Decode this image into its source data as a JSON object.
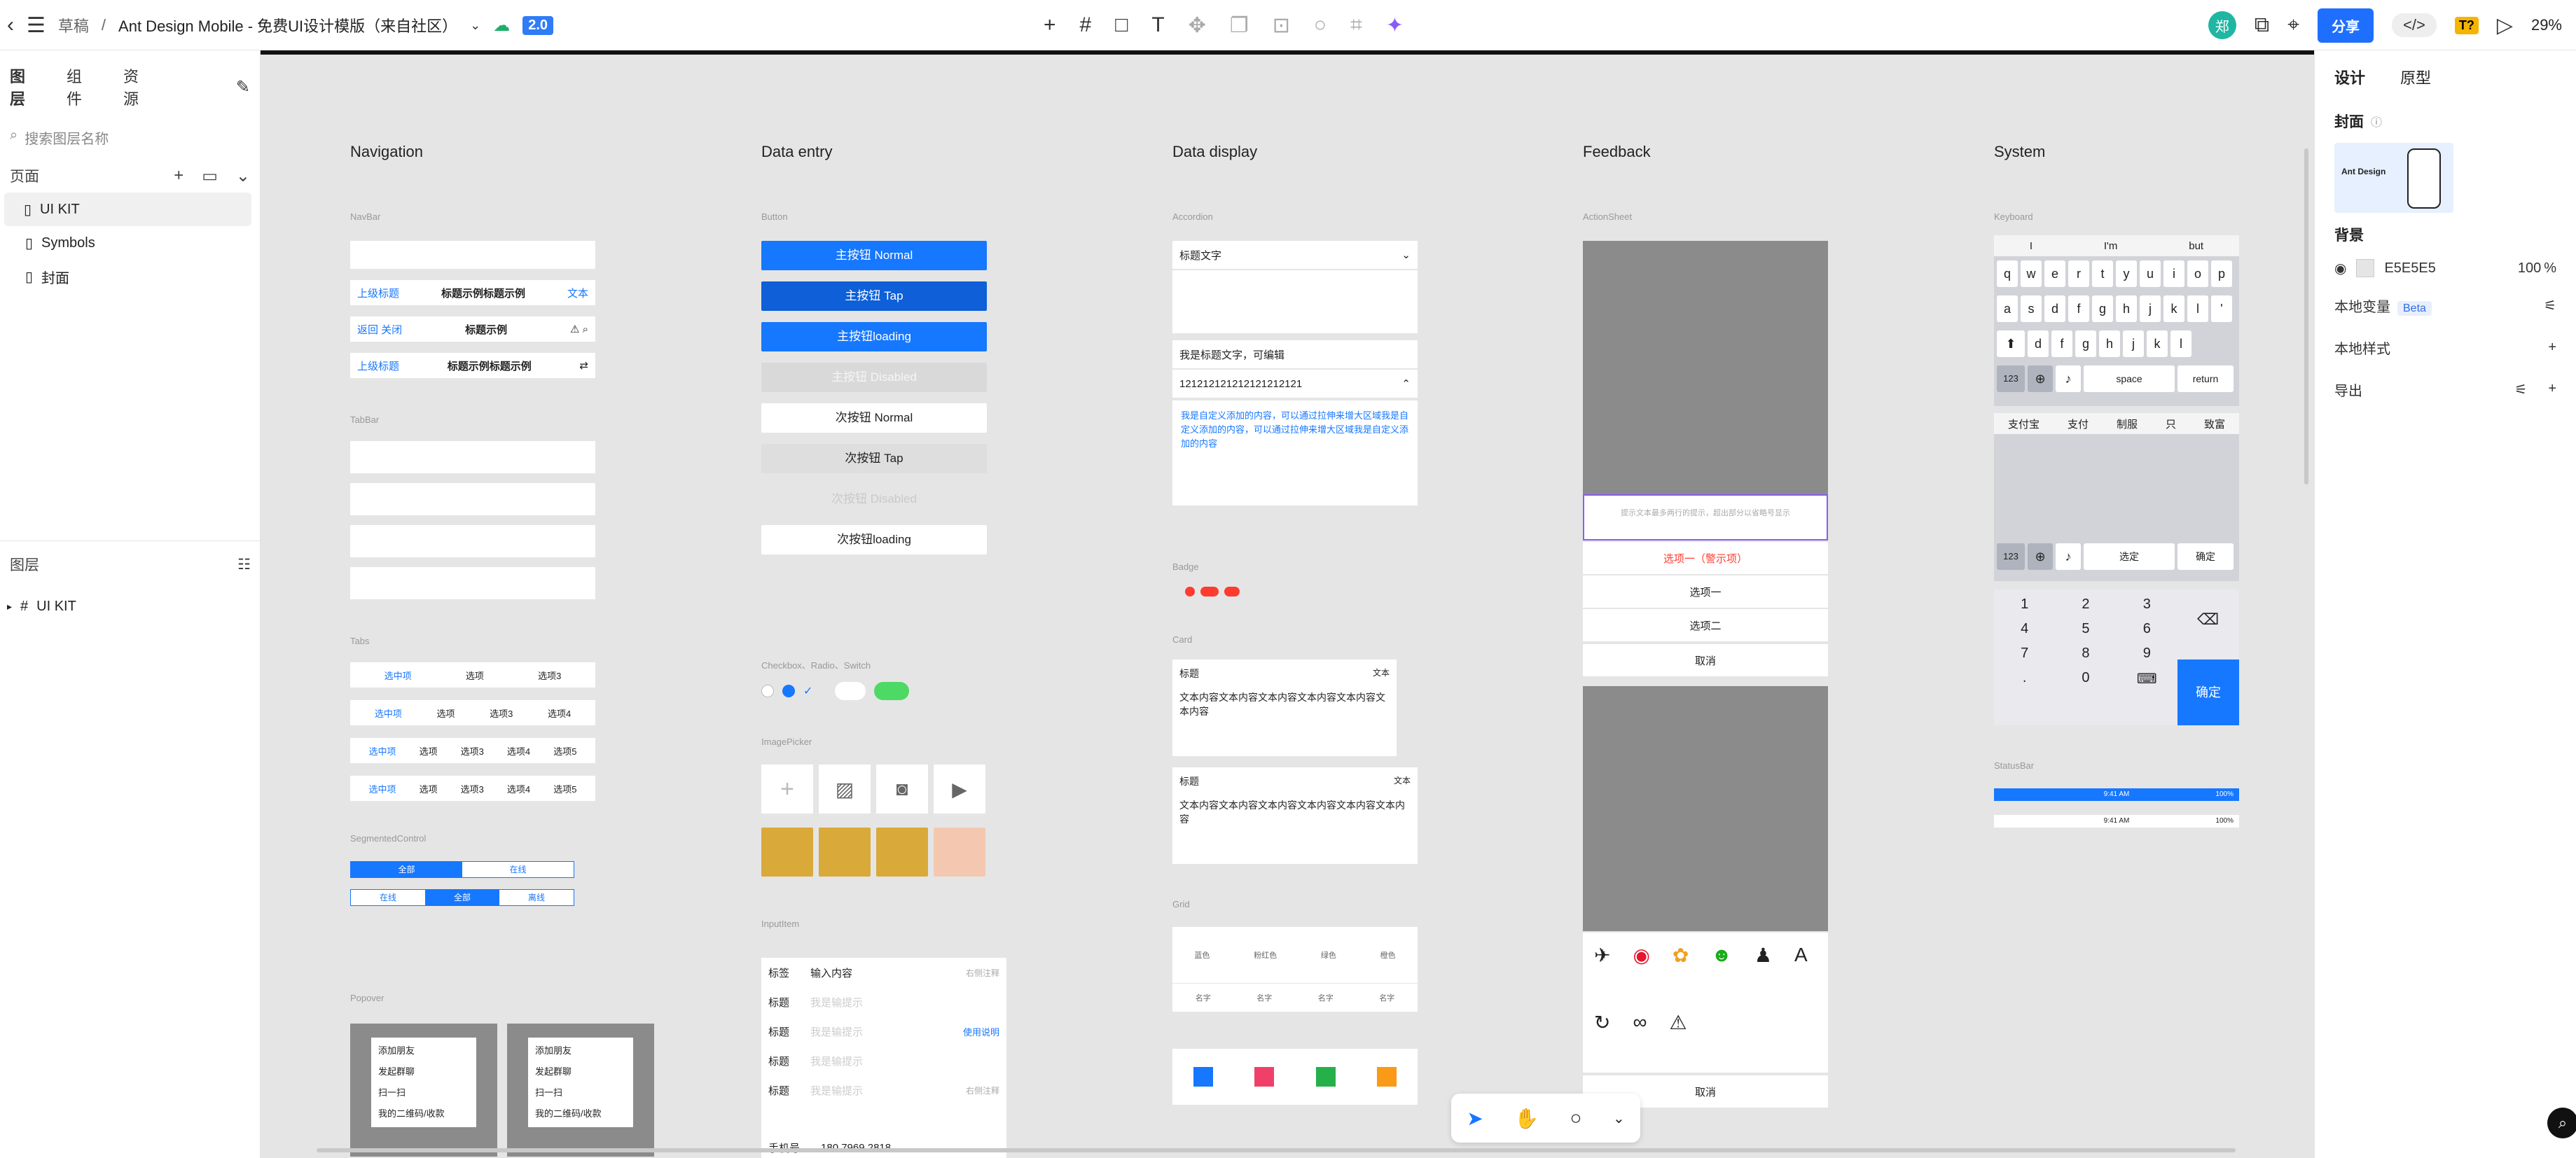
{
  "topbar": {
    "back_icon": "chevron-left-icon",
    "menu_icon": "hamburger-icon",
    "breadcrumb_root": "草稿",
    "breadcrumb_sep": "/",
    "doc_title": "Ant Design Mobile - 免费UI设计模版（来自社区）",
    "version": "2.0",
    "avatar_letter": "郑",
    "share_label": "分享",
    "beta_tag": "T?",
    "zoom": "29%"
  },
  "left_panel": {
    "tabs": [
      "图层",
      "组件",
      "资源"
    ],
    "search_placeholder": "搜索图层名称",
    "pages_label": "页面",
    "pages": [
      "UI KIT",
      "Symbols",
      "封面"
    ],
    "layers_label": "图层",
    "layers": [
      "UI KIT"
    ]
  },
  "canvas": {
    "columns": [
      "Navigation",
      "Data entry",
      "Data display",
      "Feedback",
      "System"
    ],
    "nav": {
      "navbar_label": "NavBar",
      "navbar_back": "上级标题",
      "navbar_title": "标题",
      "navbar_row2_title": "标题示例标题示例",
      "navbar_row2_right": "文本",
      "navbar_row3_back": "返回  关闭",
      "navbar_row3_title": "标题示例",
      "navbar_row4_title": "标题示例标题示例",
      "tabbar_label": "TabBar",
      "tabs_label": "Tabs",
      "tabs": [
        "选中项",
        "选项",
        "选项3",
        "选项4",
        "选项5"
      ],
      "segmented_label": "SegmentedControl",
      "segmented": [
        "全部",
        "在线",
        "离线"
      ],
      "popover_label": "Popover",
      "popover_items": [
        "添加朋友",
        "发起群聊",
        "扫一扫",
        "我的二维码/收款"
      ]
    },
    "entry": {
      "button_label": "Button",
      "buttons": [
        "主按钮 Normal",
        "主按钮 Tap",
        "主按钮loading",
        "主按钮 Disabled",
        "次按钮 Normal",
        "次按钮 Tap",
        "次按钮 Disabled",
        "次按钮loading"
      ],
      "checkbox_label": "Checkbox、Radio、Switch",
      "imagepicker_label": "ImagePicker",
      "inputitem_label": "InputItem",
      "input_rows": [
        {
          "label": "标签",
          "value": "输入内容",
          "right": "右侧注释"
        },
        {
          "label": "标题",
          "value": "我是输提示",
          "right": ""
        },
        {
          "label": "标题",
          "value": "我是输提示",
          "right": "使用说明"
        },
        {
          "label": "标题",
          "value": "我是输提示",
          "right": ""
        },
        {
          "label": "标题",
          "value": "我是输提示",
          "right": "右侧注释"
        }
      ],
      "phone_label": "手机号",
      "phone_value": "180 7969 2818"
    },
    "display": {
      "accordion_label": "Accordion",
      "accordion_title": "标题文字",
      "accordion_editable": "我是标题文字，可编辑",
      "accordion_number": "121212121212121212121",
      "accordion_body": "我是自定义添加的内容，可以通过拉伸来增大区域我是自定义添加的内容，可以通过拉伸来增大区域我是自定义添加的内容",
      "badge_label": "Badge",
      "card_label": "Card",
      "card_title": "标题",
      "card_right": "文本",
      "card_body": "文本内容文本内容文本内容文本内容文本内容文本内容",
      "grid_label": "Grid",
      "grid_items": [
        "蓝色",
        "粉红色",
        "绿色",
        "橙色"
      ],
      "grid_name": "名字"
    },
    "feedback": {
      "actionsheet_label": "ActionSheet",
      "actionsheet_hint": "提示文本最多两行的提示，超出部分以省略号显示",
      "options": [
        "选项一（警示项）",
        "选项一",
        "选项二"
      ],
      "cancel": "取消"
    },
    "system": {
      "keyboard_label": "Keyboard",
      "suggest": [
        "I",
        "I'm",
        "but"
      ],
      "row1": [
        "q",
        "w",
        "e",
        "r",
        "t",
        "y",
        "u",
        "i",
        "o",
        "p"
      ],
      "row2": [
        "a",
        "s",
        "d",
        "f",
        "g",
        "h",
        "j",
        "k",
        "l",
        "'"
      ],
      "row3": [
        "d",
        "f",
        "g",
        "h",
        "j",
        "k",
        "l"
      ],
      "space": "space",
      "return": "return",
      "cn_suggest": [
        "支付宝",
        "支付",
        "制服",
        "只",
        "致富"
      ],
      "cn_space": "选定",
      "cn_confirm": "确定",
      "num_keys": [
        "1",
        "2",
        "3",
        "4",
        "5",
        "6",
        "7",
        "8",
        "9",
        ".",
        "0"
      ],
      "num_confirm": "确定",
      "key_123": "123",
      "statusbar_label": "StatusBar",
      "statusbar_time": "9:41 AM",
      "statusbar_battery": "100%"
    }
  },
  "right_panel": {
    "tabs": [
      "设计",
      "原型"
    ],
    "cover_label": "封面",
    "cover_thumb_title": "Ant Design",
    "background_label": "背景",
    "bg_color": "E5E5E5",
    "bg_opacity": "100",
    "bg_unit": "%",
    "local_vars": "本地变量",
    "beta": "Beta",
    "local_styles": "本地样式",
    "export": "导出"
  }
}
